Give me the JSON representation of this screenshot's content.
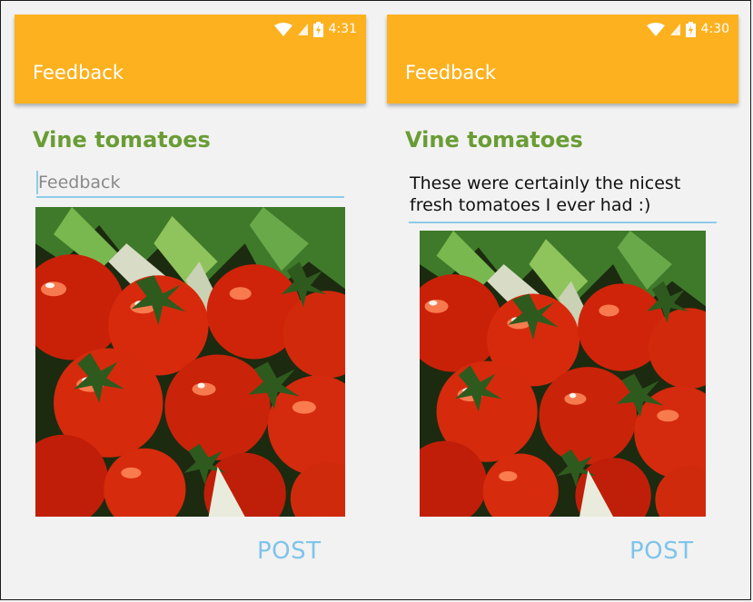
{
  "screens": {
    "left": {
      "status": {
        "time": "4:31"
      },
      "appbar": {
        "title": "Feedback"
      },
      "product": {
        "title": "Vine tomatoes"
      },
      "feedback": {
        "placeholder": "Feedback",
        "value": ""
      },
      "photo": {
        "alt": "Vine tomatoes"
      },
      "post_label": "POST"
    },
    "right": {
      "status": {
        "time": "4:30"
      },
      "appbar": {
        "title": "Feedback"
      },
      "product": {
        "title": "Vine tomatoes"
      },
      "feedback": {
        "placeholder": "Feedback",
        "value": "These were certainly the nicest fresh tomatoes I ever had :)"
      },
      "photo": {
        "alt": "Vine tomatoes"
      },
      "post_label": "POST"
    }
  },
  "colors": {
    "appbar": "#fdb11e",
    "product_title": "#6a9c35",
    "accent": "#8ecbeb",
    "button": "#7ec4ea"
  },
  "icons": [
    "wifi-icon",
    "cell-signal-icon",
    "battery-charging-icon"
  ]
}
